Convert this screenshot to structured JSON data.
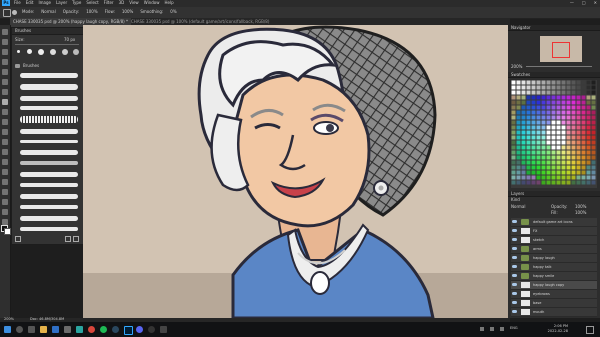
{
  "app": {
    "logo": "Ps",
    "menu": [
      "File",
      "Edit",
      "Image",
      "Layer",
      "Type",
      "Select",
      "Filter",
      "3D",
      "View",
      "Window",
      "Help"
    ],
    "window_controls": [
      "—",
      "□",
      "✕"
    ]
  },
  "options_bar": {
    "mode_label": "Mode:",
    "mode_value": "Normal",
    "opacity_label": "Opacity:",
    "opacity_value": "100%",
    "flow_label": "Flow:",
    "flow_value": "100%",
    "smoothing_label": "Smoothing:",
    "smoothing_value": "0%"
  },
  "tabs": [
    {
      "label": "CHASE 330035 psd @ 200% (happy laugh copy, RGB/8) *",
      "active": true
    },
    {
      "label": "CHASE 330035 psd @ 100% (default game/art/icons/fallback, RGB/8)",
      "active": false
    }
  ],
  "brushes_panel": {
    "title": "Brushes",
    "size_label": "Size:",
    "size_value": "70 px",
    "folder_label": "Brushes"
  },
  "navigator": {
    "title": "Navigator",
    "zoom": "200%"
  },
  "swatches": {
    "title": "Swatches"
  },
  "layers": {
    "title": "Layers",
    "kind_label": "Kind",
    "blend_mode": "Normal",
    "opacity_label": "Opacity:",
    "opacity_value": "100%",
    "fill_label": "Fill:",
    "fill_value": "100%",
    "items": [
      {
        "label": "default game art icons",
        "type": "folder"
      },
      {
        "label": "FX",
        "type": "layer"
      },
      {
        "label": "sketch",
        "type": "layer"
      },
      {
        "label": "arms",
        "type": "folder"
      },
      {
        "label": "happy laugh",
        "type": "folder"
      },
      {
        "label": "happy talk",
        "type": "folder"
      },
      {
        "label": "happy smile",
        "type": "folder"
      },
      {
        "label": "happy laugh copy",
        "type": "layer"
      },
      {
        "label": "eyebrows",
        "type": "layer"
      },
      {
        "label": "base",
        "type": "layer"
      },
      {
        "label": "mouth",
        "type": "layer"
      },
      {
        "label": "face",
        "type": "layer"
      }
    ]
  },
  "status_bar": {
    "zoom": "200%",
    "doc_info": "Doc: 46.8M/304.8M"
  },
  "taskbar": {
    "time": "2:06 PM",
    "date": "2022-02-28",
    "lang": "ENG"
  },
  "colors": {
    "ps_blue": "#31a8ff",
    "canvas_bg": "#d2c3b2",
    "skin": "#f2c8a4",
    "hair": "#ececec",
    "beret": "#7d7d7d",
    "jacket": "#5a86c6",
    "outline": "#2a2a3a"
  }
}
